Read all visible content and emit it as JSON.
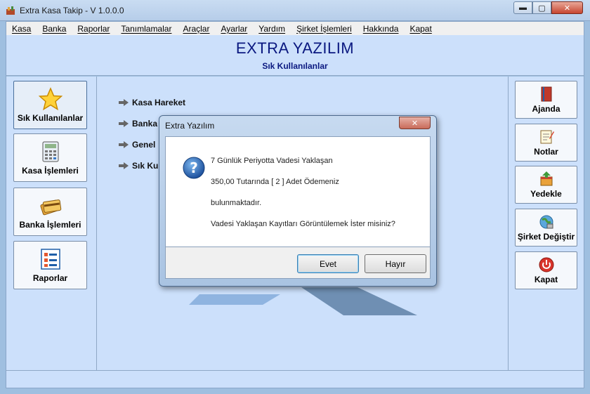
{
  "window": {
    "title": "Extra Kasa Takip - V 1.0.0.0",
    "min": "▬",
    "max": "▢",
    "close": "✕"
  },
  "menu": [
    "Kasa",
    "Banka",
    "Raporlar",
    "Tanımlamalar",
    "Araçlar",
    "Ayarlar",
    "Yardım",
    "Şirket İşlemleri",
    "Hakkında",
    "Kapat"
  ],
  "header": {
    "brand": "EXTRA YAZILIM",
    "subtitle": "Sık Kullanılanlar"
  },
  "left_buttons": [
    {
      "label": "Sık Kullanılanlar",
      "icon": "star-icon",
      "selected": true
    },
    {
      "label": "Kasa İşlemleri",
      "icon": "calculator-icon"
    },
    {
      "label": "Banka İşlemleri",
      "icon": "credit-card-icon"
    },
    {
      "label": "Raporlar",
      "icon": "report-icon"
    }
  ],
  "links": [
    "Kasa Hareket",
    "Banka",
    "Genel",
    "Sık Kul"
  ],
  "right_buttons": [
    {
      "label": "Ajanda",
      "icon": "book-icon"
    },
    {
      "label": "Notlar",
      "icon": "notes-icon"
    },
    {
      "label": "Yedekle",
      "icon": "backup-icon"
    },
    {
      "label": "Şirket Değiştir",
      "icon": "globe-icon"
    },
    {
      "label": "Kapat",
      "icon": "power-icon"
    }
  ],
  "dialog": {
    "title": "Extra Yazılım",
    "close": "✕",
    "icon": "question-icon",
    "lines": [
      "7 Günlük Periyotta Vadesi Yaklaşan",
      "350,00 Tutarında [ 2 ] Adet Ödemeniz",
      "bulunmaktadır.",
      "Vadesi Yaklaşan Kayıtları Görüntülemek İster misiniz?"
    ],
    "yes_label": "Evet",
    "no_label": "Hayır"
  },
  "colors": {
    "accent": "#0a1880",
    "panel": "#cce0fb",
    "desktop": "#9fbfe0"
  }
}
